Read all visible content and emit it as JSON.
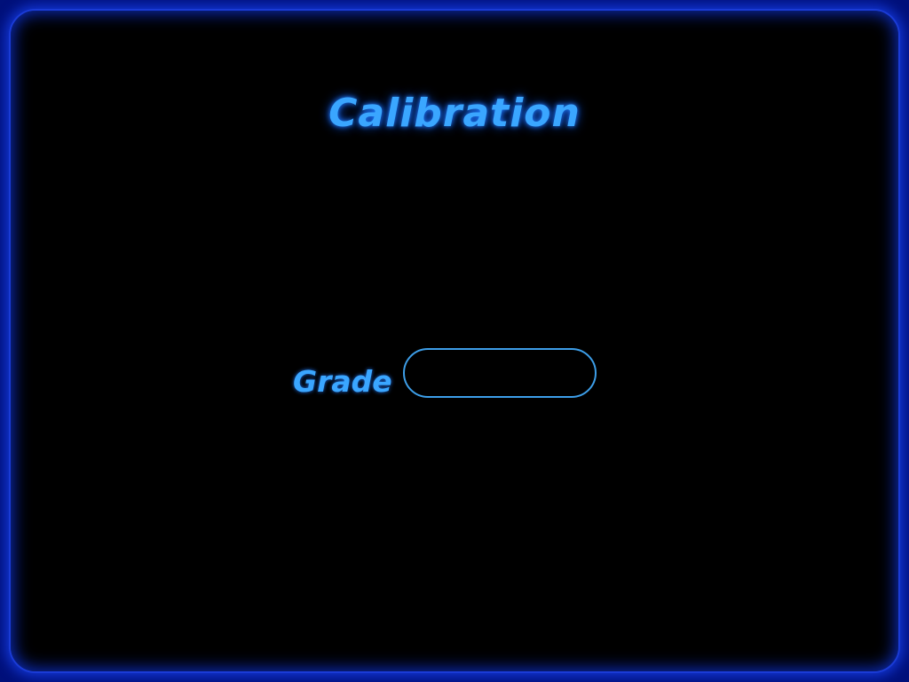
{
  "screen": {
    "title": "Calibration"
  },
  "grade": {
    "label": "Grade",
    "value": ""
  },
  "colors": {
    "background_outer": "#00107a",
    "panel": "#000000",
    "accent": "#3aa6ff",
    "border_glow": "#1236d4"
  }
}
